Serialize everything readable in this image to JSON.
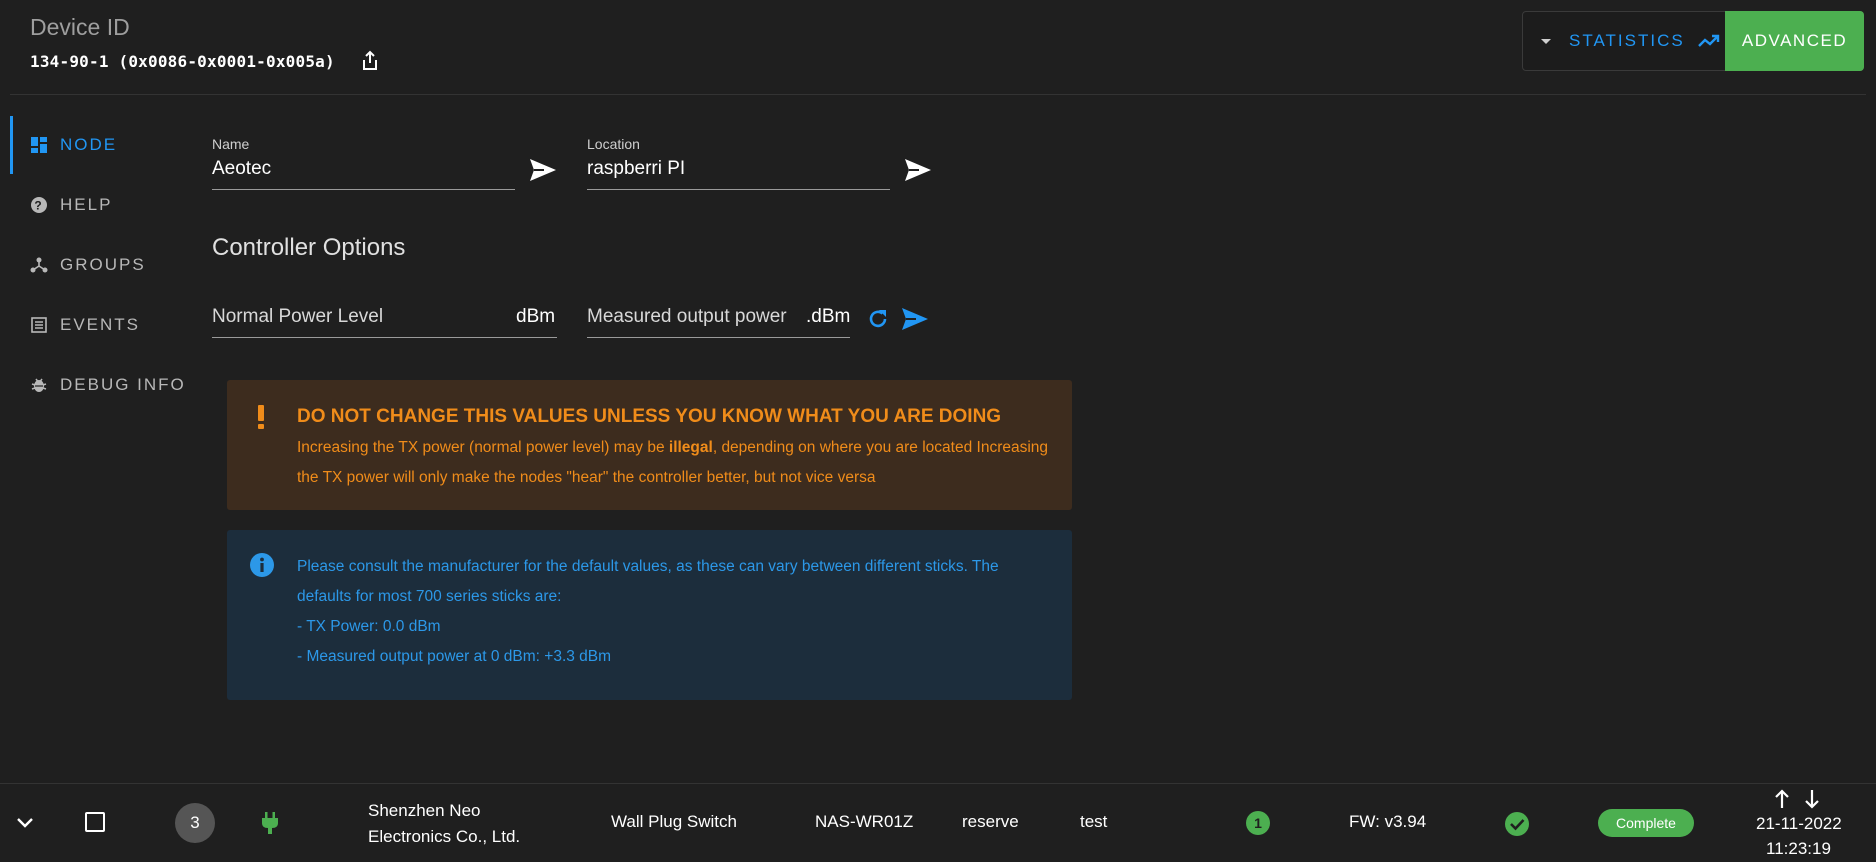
{
  "header": {
    "title": "Device ID",
    "device_id": "134-90-1 (0x0086-0x0001-0x005a)",
    "statistics_label": "STATISTICS",
    "advanced_label": "ADVANCED"
  },
  "sidebar": {
    "items": [
      {
        "label": "NODE",
        "icon": "dashboard-icon",
        "active": true
      },
      {
        "label": "HELP",
        "icon": "help-circle-icon",
        "active": false
      },
      {
        "label": "GROUPS",
        "icon": "hub-icon",
        "active": false
      },
      {
        "label": "EVENTS",
        "icon": "list-icon",
        "active": false
      },
      {
        "label": "DEBUG INFO",
        "icon": "bug-icon",
        "active": false
      }
    ]
  },
  "form": {
    "name_label": "Name",
    "name_value": "Aeotec",
    "location_label": "Location",
    "location_value": "raspberri PI"
  },
  "controller": {
    "title": "Controller Options",
    "power_level_label": "Normal Power Level",
    "power_level_unit": "dBm",
    "measured_label": "Measured output power",
    "measured_unit": ".dBm"
  },
  "warning": {
    "heading": "DO NOT CHANGE THIS VALUES UNLESS YOU KNOW WHAT YOU ARE DOING",
    "text_a": " Increasing the TX power (normal power level) may be ",
    "text_bold": "illegal",
    "text_b": ", depending on where you are located Increasing the TX power will only make the nodes \"hear\" the controller better, but not vice versa"
  },
  "info": {
    "text": "Please consult the manufacturer for the default values, as these can vary between different sticks. The defaults for most 700 series sticks are:",
    "line1": "- TX Power: 0.0 dBm",
    "line2": "- Measured output power at 0 dBm: +3.3 dBm"
  },
  "row": {
    "node_id": "3",
    "manufacturer": "Shenzhen Neo Electronics Co., Ltd.",
    "product": "Wall Plug Switch",
    "model": "NAS-WR01Z",
    "name": "reserve",
    "location": "test",
    "security_count": "1",
    "firmware": "FW: v3.94",
    "interview_status": "Complete",
    "date": "21-11-2022",
    "time": "11:23:19"
  },
  "colors": {
    "accent": "#2196f3",
    "success": "#4caf50",
    "warning": "#f08c1a",
    "background": "#1f1f1f"
  }
}
